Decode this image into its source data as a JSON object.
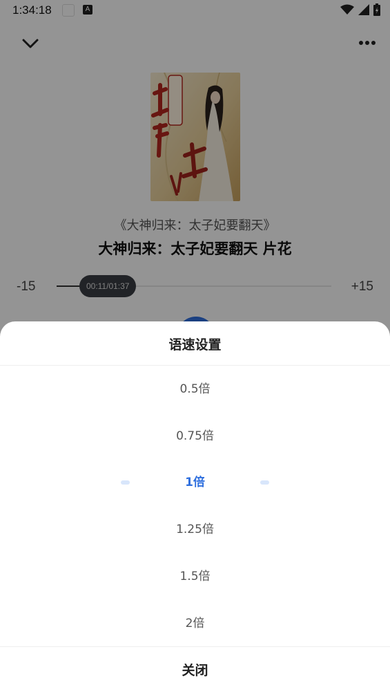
{
  "status_bar": {
    "time": "1:34:18",
    "notification_badge": "A"
  },
  "player": {
    "book_title": "《大神归来：太子妃要翻天》",
    "chapter_title": "大神归来：太子妃要翻天 片花",
    "skip_back_label": "-15",
    "skip_forward_label": "+15",
    "position_label": "00:11/01:37",
    "progress_fraction": 0.113,
    "accent_color": "#2f6fde"
  },
  "speed_sheet": {
    "title": "语速设置",
    "options": [
      {
        "label": "0.5倍",
        "selected": false
      },
      {
        "label": "0.75倍",
        "selected": false
      },
      {
        "label": "1倍",
        "selected": true
      },
      {
        "label": "1.25倍",
        "selected": false
      },
      {
        "label": "1.5倍",
        "selected": false
      },
      {
        "label": "2倍",
        "selected": false
      }
    ],
    "close_label": "关闭"
  },
  "icons": [
    "chevron-down-icon",
    "more-icon",
    "wifi-icon",
    "signal-icon",
    "battery-icon",
    "play-icon"
  ]
}
